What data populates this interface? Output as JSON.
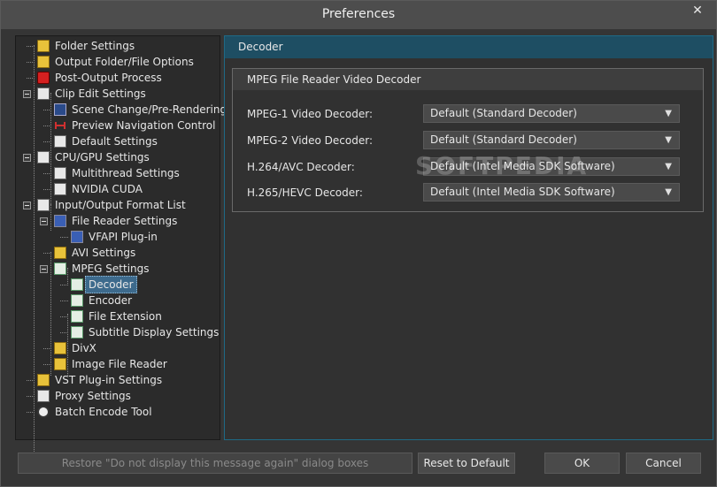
{
  "window": {
    "title": "Preferences",
    "close_glyph": "✕"
  },
  "tree": {
    "items": [
      {
        "label": "Folder Settings",
        "icon": "folder-icon"
      },
      {
        "label": "Output Folder/File Options",
        "icon": "folder-options-icon"
      },
      {
        "label": "Post-Output Process",
        "icon": "power-icon"
      },
      {
        "label": "Clip Edit Settings",
        "icon": "edit-doc-icon",
        "expanded": true
      },
      {
        "label": "Scene Change/Pre-Rendering",
        "icon": "film-icon"
      },
      {
        "label": "Preview Navigation Control",
        "icon": "navigation-icon"
      },
      {
        "label": "Default Settings",
        "icon": "edit-doc-icon"
      },
      {
        "label": "CPU/GPU Settings",
        "icon": "edit-doc-icon",
        "expanded": true
      },
      {
        "label": "Multithread Settings",
        "icon": "edit-doc-icon"
      },
      {
        "label": "NVIDIA CUDA",
        "icon": "edit-doc-icon"
      },
      {
        "label": "Input/Output Format List",
        "icon": "list-icon",
        "expanded": true
      },
      {
        "label": "File Reader Settings",
        "icon": "monitor-icon",
        "expanded": true
      },
      {
        "label": "VFAPI Plug-in",
        "icon": "monitor-icon"
      },
      {
        "label": "AVI Settings",
        "icon": "folder-doc-icon"
      },
      {
        "label": "MPEG Settings",
        "icon": "green-doc-icon",
        "expanded": true
      },
      {
        "label": "Decoder",
        "icon": "green-doc-icon",
        "selected": true
      },
      {
        "label": "Encoder",
        "icon": "green-doc-icon"
      },
      {
        "label": "File Extension",
        "icon": "green-doc-icon"
      },
      {
        "label": "Subtitle Display Settings",
        "icon": "green-doc-icon"
      },
      {
        "label": "DivX",
        "icon": "folder-doc-icon"
      },
      {
        "label": "Image File Reader",
        "icon": "folder-doc-icon"
      },
      {
        "label": "VST Plug-in Settings",
        "icon": "folder-doc-icon"
      },
      {
        "label": "Proxy Settings",
        "icon": "copy-icon"
      },
      {
        "label": "Batch Encode Tool",
        "icon": "clock-icon"
      }
    ]
  },
  "panel": {
    "header": "Decoder",
    "group_title": "MPEG File Reader Video Decoder",
    "rows": [
      {
        "label": "MPEG-1 Video Decoder:",
        "value": "Default (Standard Decoder)"
      },
      {
        "label": "MPEG-2 Video Decoder:",
        "value": "Default (Standard Decoder)"
      },
      {
        "label": "H.264/AVC Decoder:",
        "value": "Default (Intel Media SDK Software)"
      },
      {
        "label": "H.265/HEVC Decoder:",
        "value": "Default (Intel Media SDK Software)"
      }
    ],
    "dropdown_glyph": "▼"
  },
  "footer": {
    "restore_label": "Restore \"Do not display this message again\" dialog boxes",
    "reset_label": "Reset to Default",
    "ok_label": "OK",
    "cancel_label": "Cancel"
  },
  "watermark": "SOFTPEDIA"
}
